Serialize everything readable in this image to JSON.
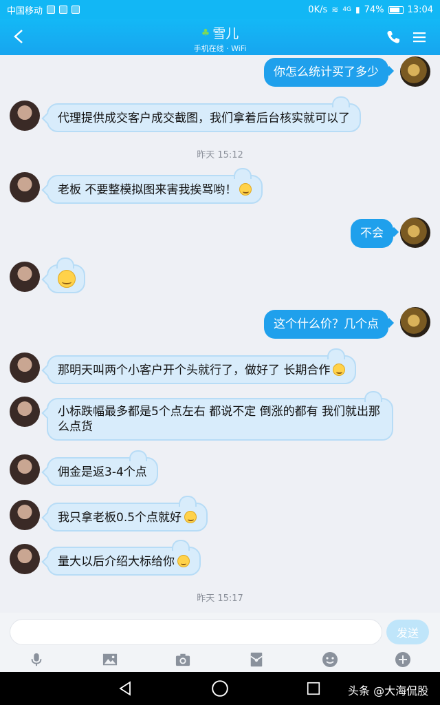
{
  "status_bar": {
    "carrier": "中国移动",
    "speed": "0K/s",
    "network": "4G",
    "battery": "74%",
    "time": "13:04"
  },
  "header": {
    "contact_name": "雪儿",
    "status": "手机在线 · WiFi"
  },
  "messages": [
    {
      "side": "out",
      "text": "你怎么统计买了多少"
    },
    {
      "side": "in",
      "text": "代理提供成交客户成交截图，我们拿着后台核实就可以了"
    },
    {
      "side": "time",
      "text": "昨天 15:12"
    },
    {
      "side": "in",
      "text": "老板 不要整模拟图来害我挨骂哟！",
      "emoji": "shy-smile"
    },
    {
      "side": "out",
      "text": "不会"
    },
    {
      "side": "in",
      "text": "",
      "emoji": "smile"
    },
    {
      "side": "out",
      "text": "这个什么价？几个点"
    },
    {
      "side": "in",
      "text": "那明天叫两个小客户开个头就行了，做好了 长期合作",
      "emoji": "grin"
    },
    {
      "side": "in",
      "text": "小标跌幅最多都是5个点左右 都说不定 倒涨的都有 我们就出那么点货"
    },
    {
      "side": "in",
      "text": "佣金是返3-4个点"
    },
    {
      "side": "in",
      "text": "我只拿老板0.5个点就好",
      "emoji": "smile"
    },
    {
      "side": "in",
      "text": "量大以后介绍大标给你",
      "emoji": "grin"
    },
    {
      "side": "time",
      "text": "昨天 15:17"
    }
  ],
  "input": {
    "placeholder": "",
    "send_label": "发送"
  },
  "toolbar_icons": [
    "microphone-icon",
    "image-icon",
    "camera-icon",
    "red-packet-icon",
    "emoji-icon",
    "plus-icon"
  ],
  "nav": {
    "watermark": "头条 @大海侃股"
  },
  "colors": {
    "header_blue": "#12b7f5",
    "out_bubble": "#1fa0ec",
    "in_bubble": "#d8ecfb"
  }
}
